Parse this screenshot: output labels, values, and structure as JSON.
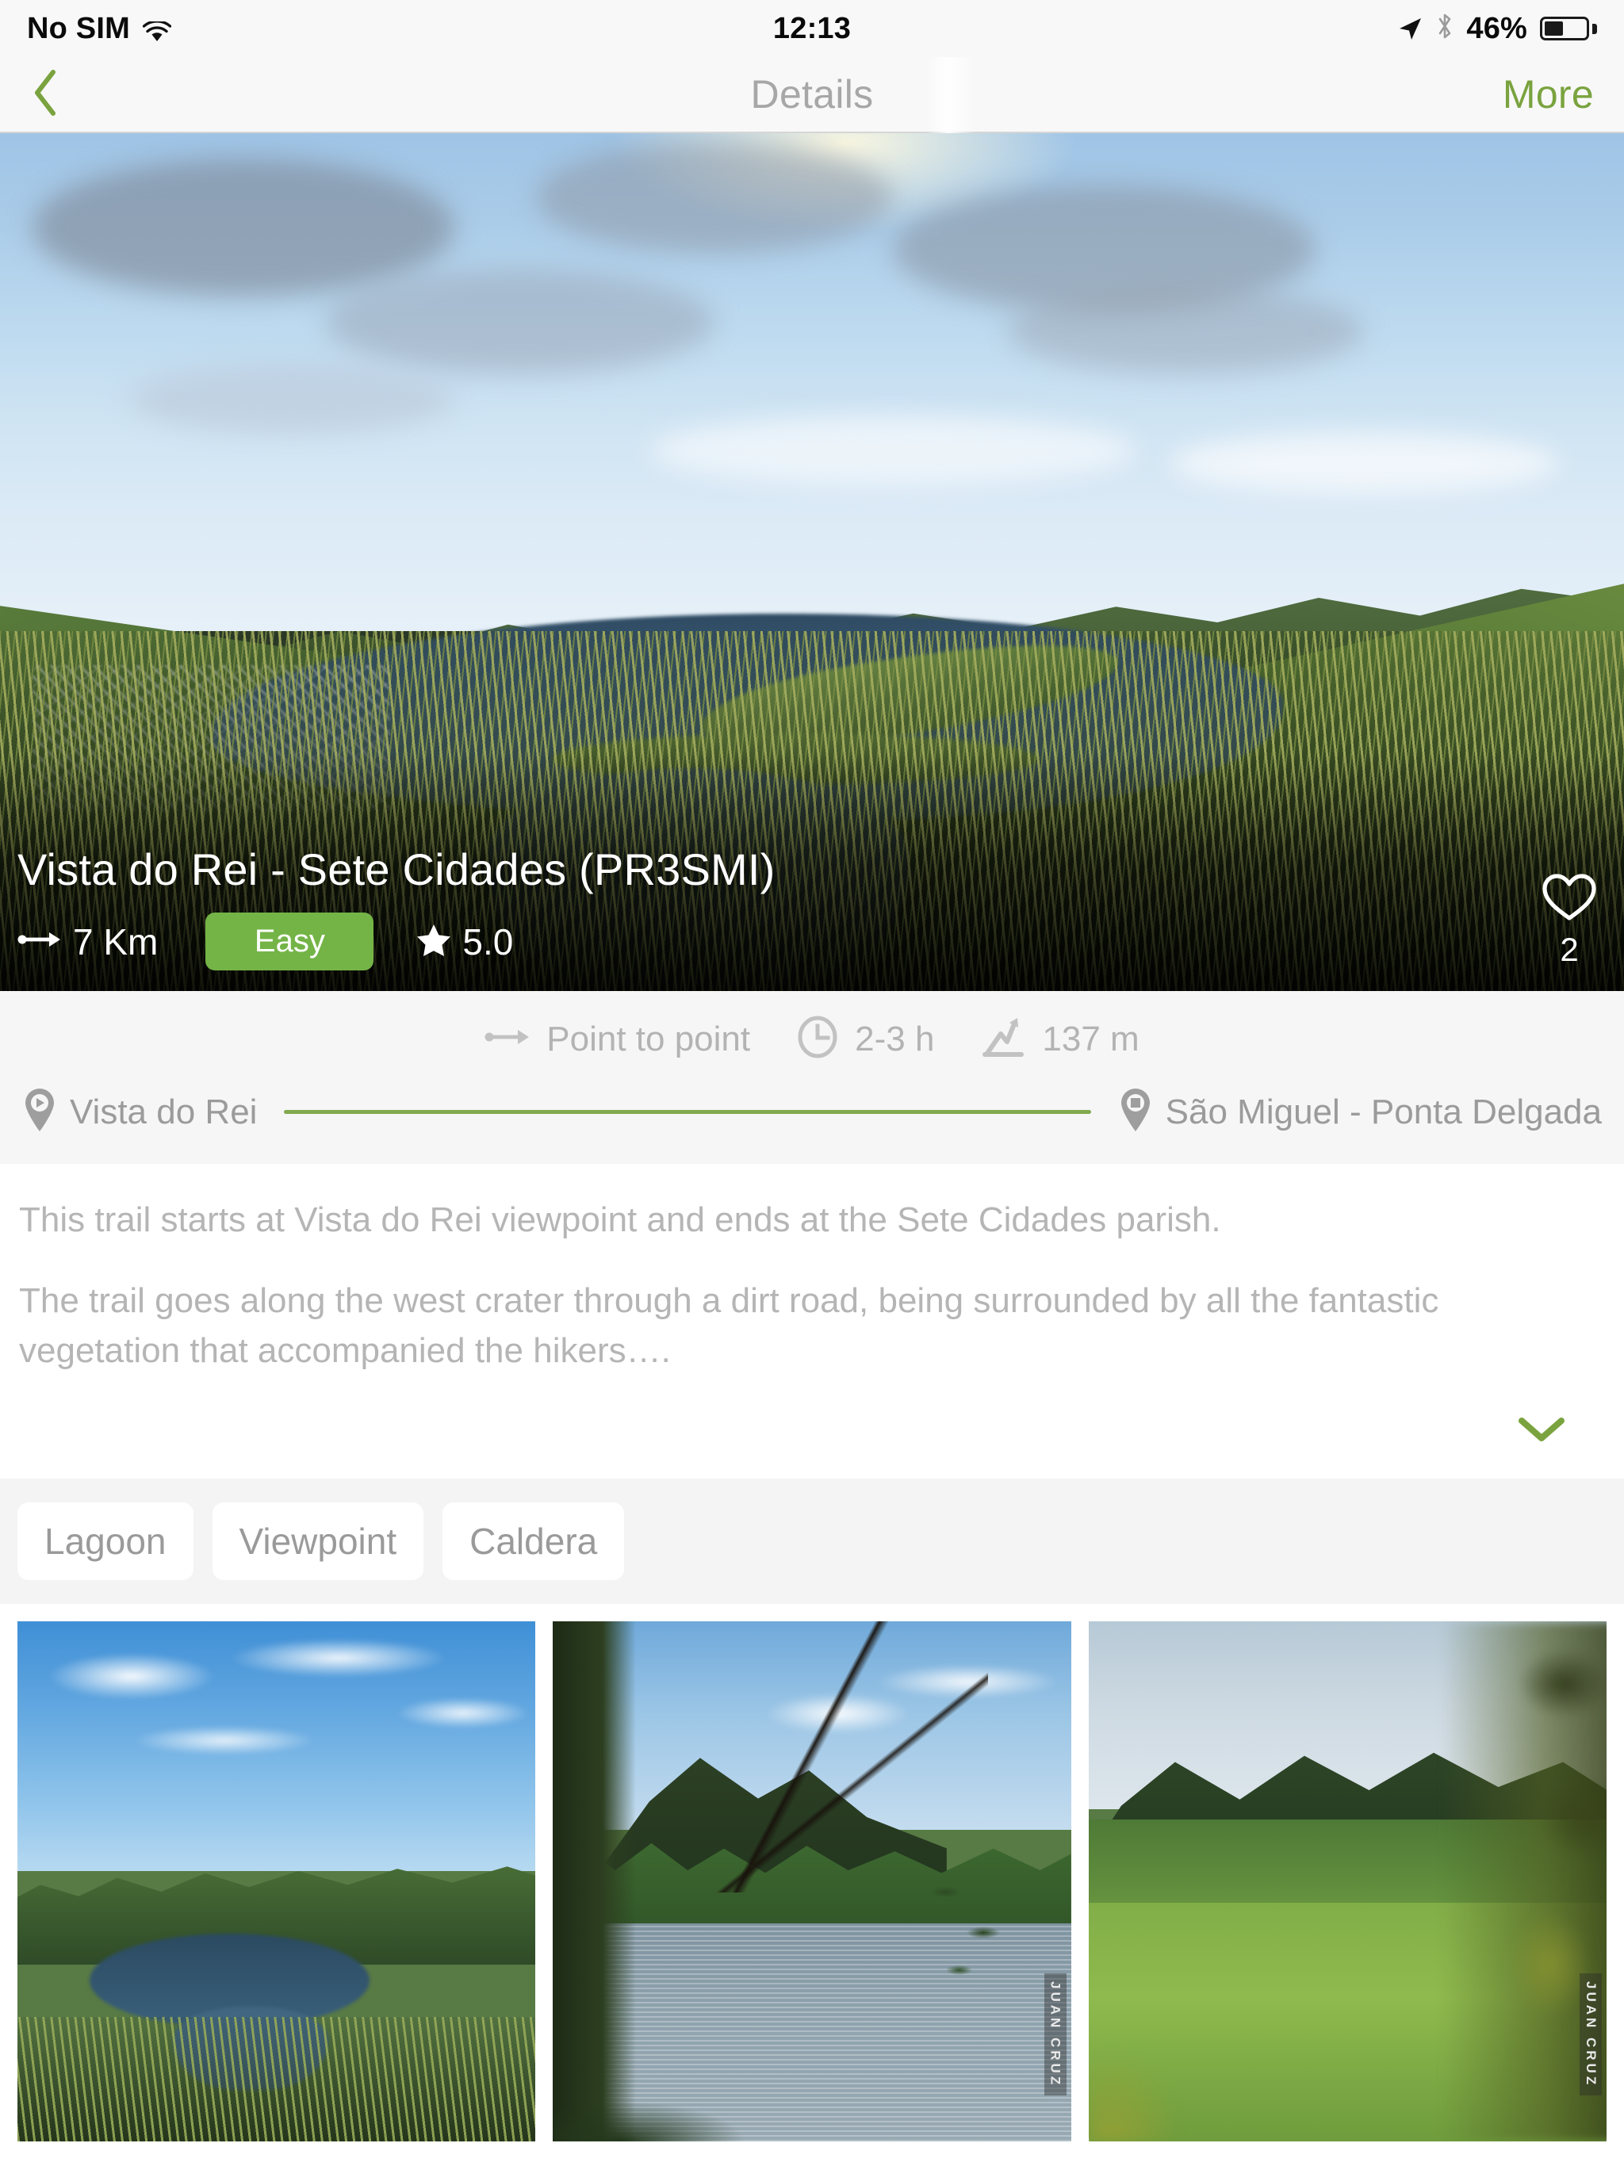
{
  "status_bar": {
    "carrier": "No SIM",
    "wifi_icon": "wifi-icon",
    "time": "12:13",
    "location_icon": "location-arrow-icon",
    "bluetooth_icon": "bluetooth-icon",
    "battery_percent": "46%",
    "battery_level": 46
  },
  "nav_bar": {
    "back_icon": "chevron-left-icon",
    "title": "Details",
    "more_label": "More",
    "accent_color": "#7aa33f"
  },
  "hero": {
    "title": "Vista do Rei - Sete Cidades (PR3SMI)",
    "distance": "7 Km",
    "distance_icon": "point-to-point-arrow-icon",
    "difficulty": "Easy",
    "difficulty_color": "#74b447",
    "rating": "5.0",
    "rating_icon": "star-icon",
    "favorite_icon": "heart-outline-icon",
    "favorite_count": "2"
  },
  "stats": [
    {
      "icon": "point-to-point-arrow-icon",
      "text": "Point to point"
    },
    {
      "icon": "clock-icon",
      "text": "2-3 h"
    },
    {
      "icon": "elevation-gain-icon",
      "text": "137 m"
    }
  ],
  "route": {
    "start_icon": "map-pin-start-icon",
    "start": "Vista do Rei",
    "end_icon": "map-pin-end-icon",
    "end": "São Miguel - Ponta Delgada",
    "line_color": "#82ab50"
  },
  "description": {
    "paragraphs": [
      "This trail starts at Vista do Rei viewpoint and ends at the Sete Cidades parish.",
      "The trail goes along the west crater through a dirt road, being surrounded by all the fantastic vegetation that accompanied the hikers…."
    ],
    "expand_icon": "chevron-down-icon",
    "expand_color": "#7aa33f"
  },
  "tags": [
    "Lagoon",
    "Viewpoint",
    "Caldera"
  ],
  "gallery": [
    {
      "name": "crater-lake-aerial-photo",
      "watermark": ""
    },
    {
      "name": "lake-through-branches-photo",
      "watermark": "JUAN CRUZ"
    },
    {
      "name": "green-fields-valley-photo",
      "watermark": "JUAN CRUZ"
    }
  ]
}
